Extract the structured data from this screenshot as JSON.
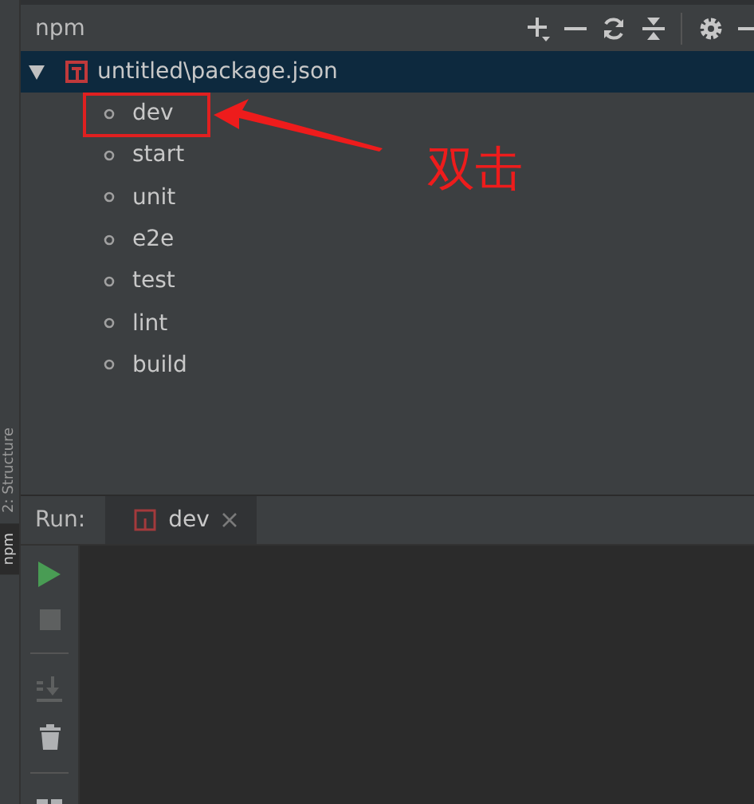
{
  "side_tabs": [
    {
      "label": "2: Structure",
      "selected": false
    },
    {
      "label": "npm",
      "selected": true
    }
  ],
  "npm_panel": {
    "title": "npm",
    "tree": {
      "label": "untitled\\package.json",
      "expanded": true,
      "selected": true,
      "children": [
        {
          "label": "dev",
          "selected": false
        },
        {
          "label": "start",
          "selected": false
        },
        {
          "label": "unit",
          "selected": false
        },
        {
          "label": "e2e",
          "selected": false
        },
        {
          "label": "test",
          "selected": false
        },
        {
          "label": "lint",
          "selected": false
        },
        {
          "label": "build",
          "selected": false
        }
      ]
    }
  },
  "annotation": {
    "text": "双击"
  },
  "run_panel": {
    "label": "Run:",
    "tabs": [
      {
        "label": "dev",
        "selected": true
      }
    ]
  }
}
